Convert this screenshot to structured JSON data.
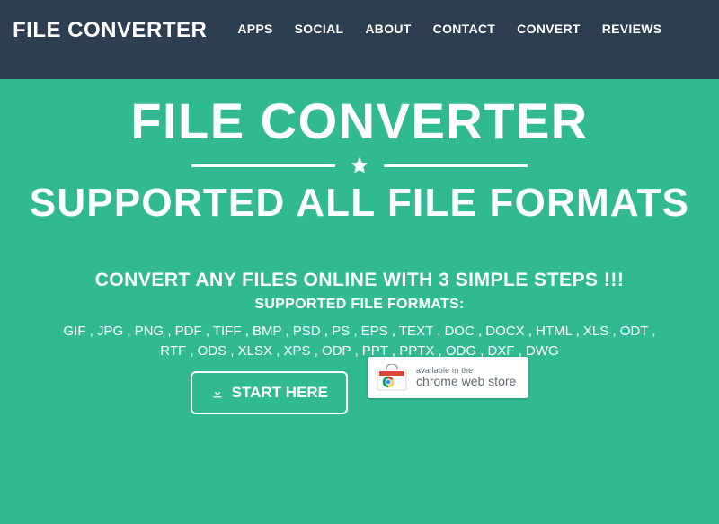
{
  "brand": "FILE CONVERTER",
  "nav": [
    "APPS",
    "SOCIAL",
    "ABOUT",
    "CONTACT",
    "CONVERT",
    "REVIEWS"
  ],
  "hero": {
    "title": "FILE CONVERTER",
    "subtitle": "SUPPORTED ALL FILE FORMATS",
    "tagline": "CONVERT ANY FILES ONLINE WITH 3 SIMPLE STEPS !!!",
    "formats_heading": "SUPPORTED FILE FORMATS:",
    "formats": "GIF , JPG , PNG , PDF , TIFF , BMP , PSD , PS , EPS , TEXT , DOC , DOCX , HTML , XLS , ODT , RTF , ODS , XLSX , XPS , ODP , PPT , PPTX , ODG , DXF , DWG",
    "start_button": "START HERE",
    "chrome_badge_small": "available in the",
    "chrome_badge_large": "chrome web store"
  },
  "colors": {
    "navbar_bg": "#2c3e50",
    "hero_bg": "#31b992",
    "text": "#ffffff"
  }
}
